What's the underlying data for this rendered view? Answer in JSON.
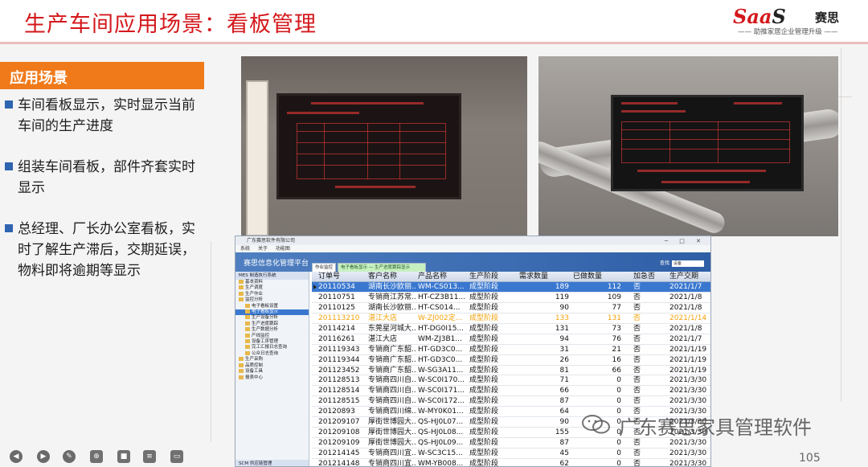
{
  "header": {
    "title": "生产车间应用场景：看板管理",
    "brand": {
      "logo_text": "SaaS",
      "cn": "赛思",
      "slogan": "—— 助推家居企业管理升级 ——"
    }
  },
  "section": {
    "title": "应用场景"
  },
  "bullets": [
    "车间看板显示，实时显示当前车间的生产进度",
    "组装车间看板，部件齐套实时显示",
    "总经理、厂长办公室看板，实时了解生产滞后，交期延误，物料即将逾期等显示"
  ],
  "photos": [
    {
      "icon": "led-board-photo-1"
    },
    {
      "icon": "led-board-photo-2"
    }
  ],
  "software": {
    "window_title": "广东赛思软件有限公司",
    "menu": [
      "系统",
      "关于",
      "功能图"
    ],
    "banner_title": "赛思信息化管理平台",
    "search_label": "查找",
    "search_value": "设备",
    "tree_title": "MES 制造执行系统",
    "tree_items": [
      "基本资料",
      "生产调度",
      "生产作业",
      "监控分析",
      "电子看板设置",
      "电子看板显示",
      "生产设备分析",
      "生产进度跟踪",
      "生产数据分析",
      "产线监控",
      "设备工序管理",
      "完工汇报日志查询",
      "公众日志查询",
      "生产采购",
      "品质控制",
      "设备工具",
      "报表中心"
    ],
    "tree_footer": "SCM 供应链管理",
    "tabs": [
      "作业监控",
      "电子看板显示 — 生产进度跟踪显示"
    ],
    "columns": [
      "订单号",
      "客户名称",
      "产品名称",
      "生产阶段",
      "需求数量",
      "已做数量",
      "加急否",
      "生产交期"
    ],
    "rows": [
      [
        "20110534",
        "湖南长沙欧丽...",
        "WM-CS013...",
        "成型阶段",
        "189",
        "112",
        "否",
        "2021/1/7"
      ],
      [
        "20110751",
        "专销商江苏常...",
        "HT-CZ3B11...",
        "成型阶段",
        "119",
        "109",
        "否",
        "2021/1/8"
      ],
      [
        "20110125",
        "湖南长沙欧丽...",
        "HT-CS014...",
        "成型阶段",
        "90",
        "77",
        "否",
        "2021/1/8"
      ],
      [
        "201113210",
        "湛江大店",
        "W-ZJ002定...",
        "成型阶段",
        "133",
        "131",
        "否",
        "2021/1/14"
      ],
      [
        "20114214",
        "东莞星河城大...",
        "HT-DG0I15...",
        "成型阶段",
        "131",
        "73",
        "否",
        "2021/1/8"
      ],
      [
        "20116261",
        "湛江大店",
        "WM-ZJ3B1...",
        "成型阶段",
        "94",
        "76",
        "否",
        "2021/1/7"
      ],
      [
        "201119343",
        "专销商广东韶...",
        "HT-GD3C0...",
        "成型阶段",
        "31",
        "21",
        "否",
        "2021/1/19"
      ],
      [
        "201119344",
        "专销商广东韶...",
        "HT-GD3C0...",
        "成型阶段",
        "26",
        "16",
        "否",
        "2021/1/19"
      ],
      [
        "201123452",
        "专销商广东韶...",
        "W-SG3A11...",
        "成型阶段",
        "81",
        "66",
        "否",
        "2021/1/19"
      ],
      [
        "201128513",
        "专销商四川自...",
        "W-SC0I170...",
        "成型阶段",
        "71",
        "0",
        "否",
        "2021/3/30"
      ],
      [
        "201128514",
        "专销商四川自...",
        "W-SC0I171...",
        "成型阶段",
        "66",
        "0",
        "否",
        "2021/3/30"
      ],
      [
        "201128515",
        "专销商四川自...",
        "W-SC0I172...",
        "成型阶段",
        "87",
        "0",
        "否",
        "2021/3/30"
      ],
      [
        "20120893",
        "专销商四川绵...",
        "W-MY0K01...",
        "成型阶段",
        "64",
        "0",
        "否",
        "2021/3/30"
      ],
      [
        "201209107",
        "厚街世博园大...",
        "QS-HJ0L07...",
        "成型阶段",
        "90",
        "0",
        "否",
        "2021/3/30"
      ],
      [
        "201209108",
        "厚街世博园大...",
        "QS-HJ0L08...",
        "成型阶段",
        "155",
        "0",
        "否",
        "2021/3/30"
      ],
      [
        "201209109",
        "厚街世博园大...",
        "QS-HJ0L09...",
        "成型阶段",
        "87",
        "0",
        "否",
        "2021/3/30"
      ],
      [
        "201214145",
        "专销商四川宜...",
        "W-SC3C15...",
        "成型阶段",
        "45",
        "0",
        "否",
        "2021/3/30"
      ],
      [
        "201214148",
        "专销商四川宜...",
        "WM-YB008...",
        "成型阶段",
        "62",
        "0",
        "否",
        "2021/3/30"
      ]
    ],
    "selected_row": 0,
    "highlight_row": 3,
    "highlight_color": "#f2a20a",
    "selection_color": "#3a78d0"
  },
  "footer": {
    "watermark": "广东赛思家具管理软件",
    "page_number": "105",
    "toolbar_icons": [
      "prev-icon",
      "next-icon",
      "pen-icon",
      "zoom-icon",
      "camera-icon",
      "subtitle-icon",
      "monitor-icon"
    ]
  },
  "colors": {
    "title_red": "#d4181c",
    "section_orange": "#f07a1a",
    "bullet_blue": "#2f64b0"
  }
}
